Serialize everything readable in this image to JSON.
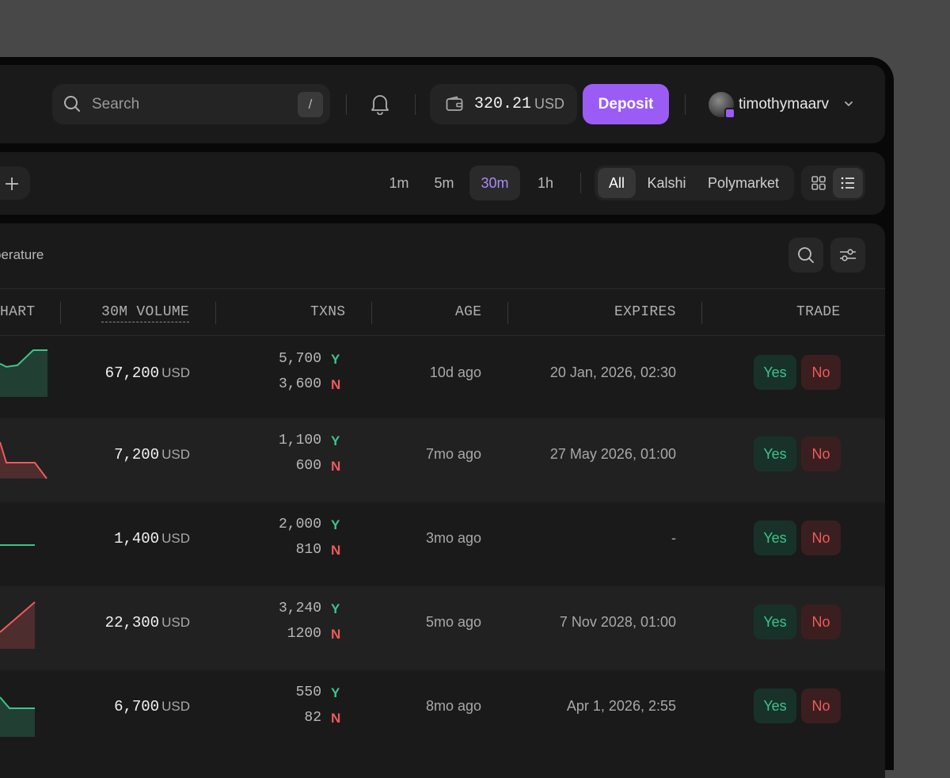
{
  "header": {
    "search_placeholder": "Search",
    "search_shortcut": "/",
    "balance_amount": "320.21",
    "balance_currency": "USD",
    "deposit_label": "Deposit",
    "username": "timothymaarv"
  },
  "filters": {
    "timeframes": [
      {
        "label": "1m",
        "active": false
      },
      {
        "label": "5m",
        "active": false
      },
      {
        "label": "30m",
        "active": true
      },
      {
        "label": "1h",
        "active": false
      }
    ],
    "sources": [
      {
        "label": "All",
        "active": true
      },
      {
        "label": "Kalshi",
        "active": false
      },
      {
        "label": "Polymarket",
        "active": false
      }
    ],
    "view_modes": [
      {
        "icon": "grid-view-icon",
        "active": false
      },
      {
        "icon": "list-view-icon",
        "active": true
      }
    ]
  },
  "table": {
    "title_fragment": "perature",
    "columns": [
      "HART",
      "30M VOLUME",
      "TXNS",
      "AGE",
      "EXPIRES",
      "TRADE"
    ],
    "yes_label": "Yes",
    "no_label": "No",
    "txn_yes_marker": "Y",
    "txn_no_marker": "N",
    "rows": [
      {
        "volume": "67,200",
        "unit": "USD",
        "txns_yes": "5,700",
        "txns_no": "3,600",
        "age": "10d ago",
        "expires": "20 Jan, 2026, 02:30",
        "trend": "up",
        "color": "#3cc58a"
      },
      {
        "volume": "7,200",
        "unit": "USD",
        "txns_yes": "1,100",
        "txns_no": "600",
        "age": "7mo ago",
        "expires": "27 May 2026, 01:00",
        "trend": "down",
        "color": "#ef5a5a"
      },
      {
        "volume": "1,400",
        "unit": "USD",
        "txns_yes": "2,000",
        "txns_no": "810",
        "age": "3mo ago",
        "expires": "-",
        "trend": "flat",
        "color": "#3cc58a"
      },
      {
        "volume": "22,300",
        "unit": "USD",
        "txns_yes": "3,240",
        "txns_no": "1200",
        "age": "5mo ago",
        "expires": "7 Nov 2028, 01:00",
        "trend": "up",
        "color": "#ef5a5a"
      },
      {
        "volume": "6,700",
        "unit": "USD",
        "txns_yes": "550",
        "txns_no": "82",
        "age": "8mo ago",
        "expires": "Apr 1, 2026, 2:55",
        "trend": "down",
        "color": "#3cc58a"
      }
    ]
  }
}
